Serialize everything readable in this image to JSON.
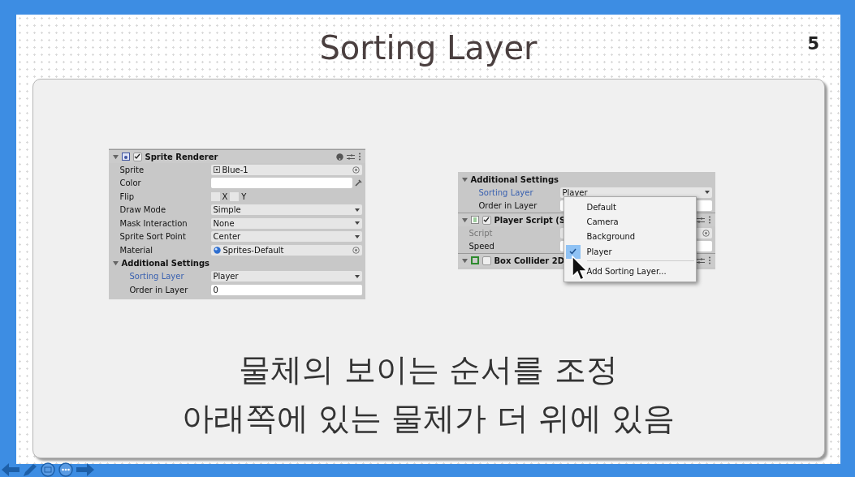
{
  "slide": {
    "title": "Sorting Layer",
    "page_number": "5",
    "inspector_left": [
      {
        "kind": "component",
        "title": "Sprite Renderer",
        "enabled": true,
        "expanded": true,
        "children": [
          {
            "kind": "sprite",
            "label": "Sprite",
            "value": "Blue-1"
          },
          {
            "kind": "color",
            "label": "Color"
          },
          {
            "kind": "flip",
            "label": "Flip",
            "options": [
              {
                "label": "X",
                "checked": false
              },
              {
                "label": "Y",
                "checked": false
              }
            ]
          },
          {
            "kind": "dropdown",
            "label": "Draw Mode",
            "value": "Simple"
          },
          {
            "kind": "dropdown",
            "label": "Mask Interaction",
            "value": "None"
          },
          {
            "kind": "dropdown",
            "label": "Sprite Sort Point",
            "value": "Center"
          },
          {
            "kind": "material",
            "label": "Material",
            "value": "Sprites-Default"
          },
          {
            "kind": "section",
            "title": "Additional Settings",
            "expanded": true,
            "children": [
              {
                "kind": "dropdown",
                "label": "Sorting Layer",
                "value": "Player",
                "highlighted": true
              },
              {
                "kind": "number",
                "label": "Order in Layer",
                "value": "0",
                "highlighted": false
              }
            ]
          }
        ]
      }
    ],
    "inspector_right": [
      {
        "kind": "section",
        "title": "Additional Settings",
        "expanded": true,
        "children": [
          {
            "kind": "dropdown",
            "label": "Sorting Layer",
            "value": "Player",
            "highlighted": true
          },
          {
            "kind": "number",
            "label": "Order in Layer",
            "highlighted": false
          }
        ]
      },
      {
        "kind": "component",
        "title": "Player Script (S",
        "enabled": true,
        "expanded": true,
        "children": [
          {
            "kind": "script",
            "label": "Script",
            "disabled": true
          },
          {
            "kind": "number",
            "label": "Speed"
          }
        ]
      },
      {
        "kind": "component",
        "title": "Box Collider 2D",
        "enabled": false,
        "expanded": true
      }
    ],
    "dropdown_menu": {
      "items": [
        {
          "label": "Default",
          "selected": false
        },
        {
          "label": "Camera",
          "selected": false
        },
        {
          "label": "Background",
          "selected": false
        },
        {
          "label": "Player",
          "selected": true
        }
      ],
      "add_item": "Add Sorting Layer..."
    },
    "captions": [
      "물체의 보이는 순서를 조정",
      "아래쪽에 있는 물체가 더 위에 있음"
    ]
  }
}
